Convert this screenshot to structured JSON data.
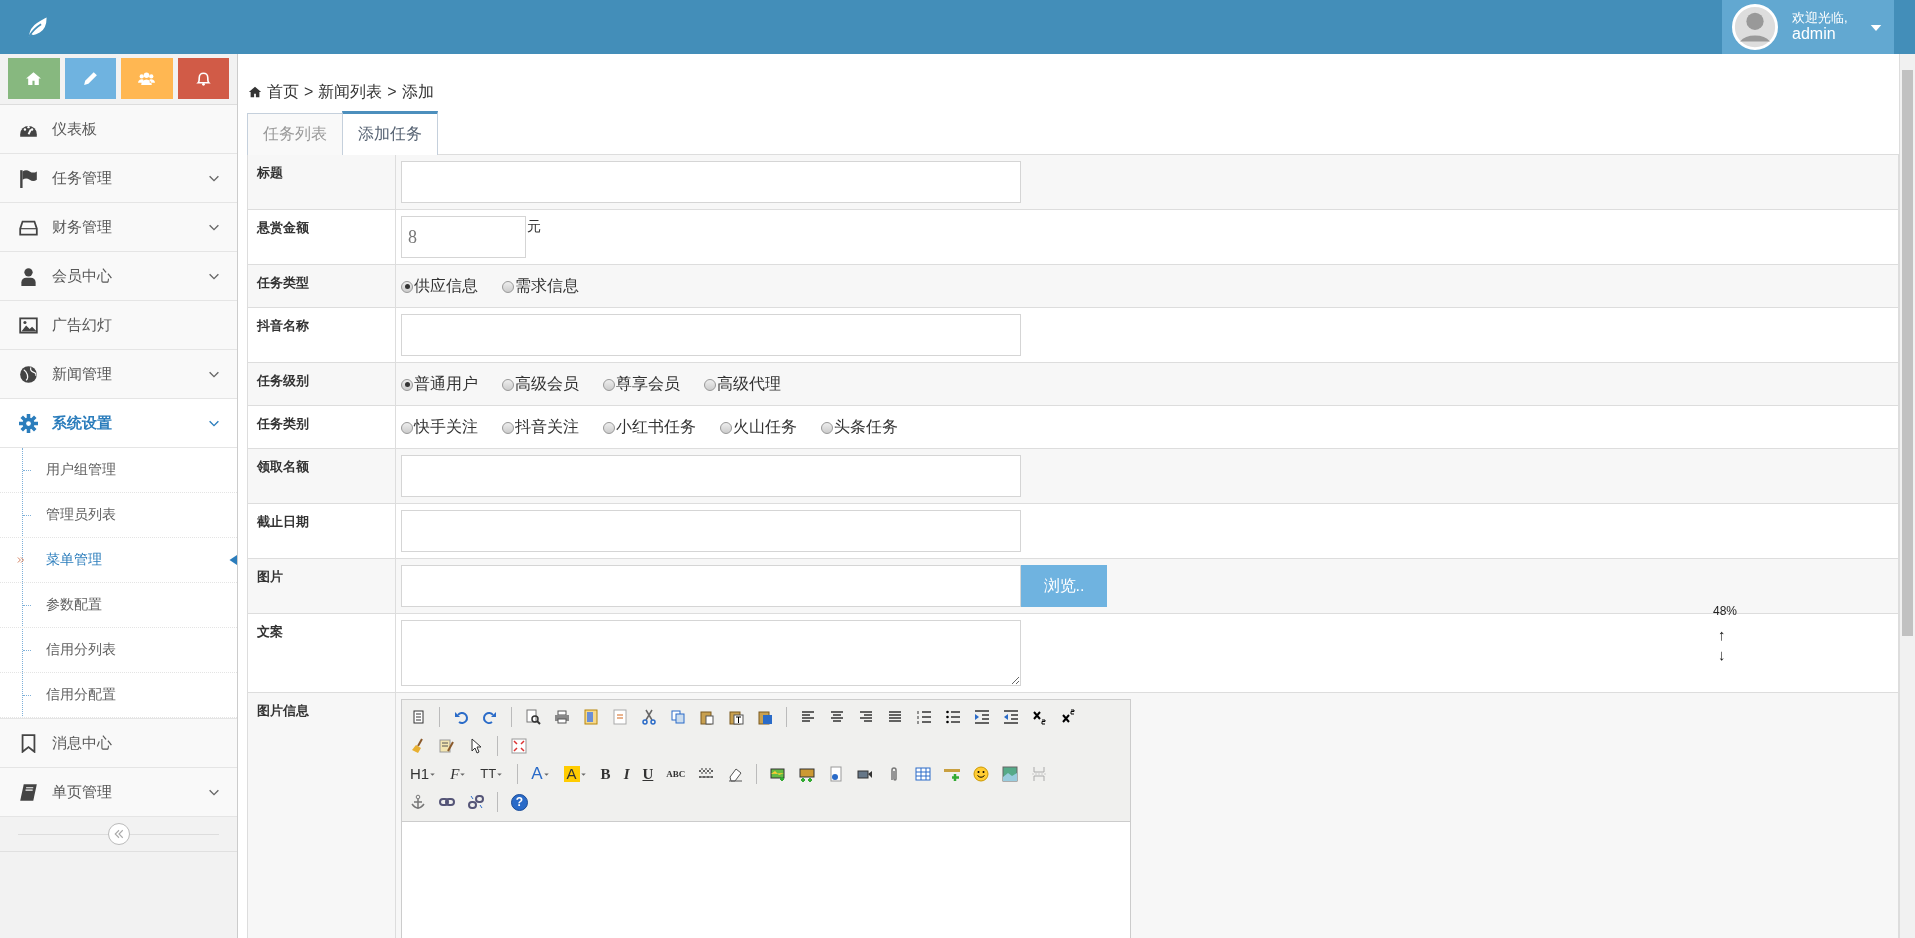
{
  "header": {
    "greeting": "欢迎光临,",
    "username": "admin"
  },
  "sidebar": {
    "shortcuts": [
      {
        "color": "#87b87f"
      },
      {
        "color": "#6fb3e0"
      },
      {
        "color": "#ffb752"
      },
      {
        "color": "#d15b47"
      }
    ],
    "items": [
      {
        "label": "仪表板",
        "selected": false
      },
      {
        "label": "任务管理",
        "selected": false,
        "expanded": false
      },
      {
        "label": "财务管理",
        "selected": false,
        "expanded": false
      },
      {
        "label": "会员中心",
        "selected": false,
        "expanded": false
      },
      {
        "label": "广告幻灯",
        "selected": false
      },
      {
        "label": "新闻管理",
        "selected": false,
        "expanded": false
      },
      {
        "label": "系统设置",
        "selected": true,
        "expanded": true,
        "children": [
          {
            "label": "用户组管理",
            "selected": false
          },
          {
            "label": "管理员列表",
            "selected": false
          },
          {
            "label": "菜单管理",
            "selected": true
          },
          {
            "label": "参数配置",
            "selected": false
          },
          {
            "label": "信用分列表",
            "selected": false
          },
          {
            "label": "信用分配置",
            "selected": false
          }
        ]
      },
      {
        "label": "消息中心",
        "selected": false
      },
      {
        "label": "单页管理",
        "selected": false,
        "expanded": false
      }
    ]
  },
  "breadcrumb": [
    "首页",
    "新闻列表",
    "添加"
  ],
  "breadcrumb_separator": ">",
  "tabs": [
    {
      "label": "任务列表",
      "selected": false
    },
    {
      "label": "添加任务",
      "selected": true
    }
  ],
  "form": [
    {
      "label": "标题",
      "kind": "text"
    },
    {
      "label": "悬赏金额",
      "kind": "amount",
      "value": "8",
      "unit": "元"
    },
    {
      "label": "任务类型",
      "kind": "radio",
      "options": [
        {
          "label": "供应信息",
          "selected": true
        },
        {
          "label": "需求信息",
          "selected": false
        }
      ]
    },
    {
      "label": "抖音名称",
      "kind": "text"
    },
    {
      "label": "任务级别",
      "kind": "radio",
      "options": [
        {
          "label": "普通用户",
          "selected": true
        },
        {
          "label": "高级会员",
          "selected": false
        },
        {
          "label": "尊享会员",
          "selected": false
        },
        {
          "label": "高级代理",
          "selected": false
        }
      ]
    },
    {
      "label": "任务类别",
      "kind": "radio",
      "options": [
        {
          "label": "快手关注",
          "selected": false
        },
        {
          "label": "抖音关注",
          "selected": false
        },
        {
          "label": "小红书任务",
          "selected": false
        },
        {
          "label": "火山任务",
          "selected": false
        },
        {
          "label": "头条任务",
          "selected": false
        }
      ]
    },
    {
      "label": "领取名额",
      "kind": "text"
    },
    {
      "label": "截止日期",
      "kind": "text"
    },
    {
      "label": "图片",
      "kind": "file",
      "button": "浏览.."
    },
    {
      "label": "文案",
      "kind": "textarea"
    },
    {
      "label": "图片信息",
      "kind": "editor",
      "labels": [
        "H1",
        "F",
        "TT",
        "A",
        "A",
        "B",
        "I",
        "U",
        "ABC",
        "?"
      ]
    }
  ],
  "resize_widget": {
    "percent": "48%",
    "up": "↑",
    "down": "↓"
  }
}
